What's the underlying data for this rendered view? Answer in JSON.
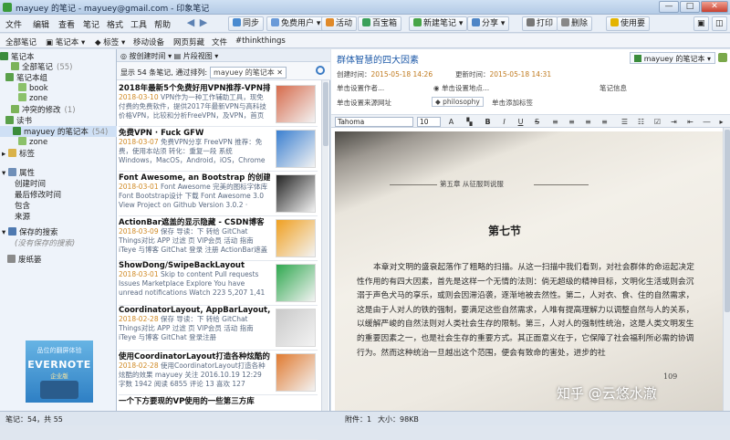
{
  "window": {
    "title": "mayuey 的笔记 - mayuey@gmail.com - 印象笔记",
    "minimize": "—",
    "maximize": "□",
    "close": "✕"
  },
  "menu": [
    "文件",
    "编辑",
    "查看",
    "笔记",
    "格式",
    "工具",
    "帮助"
  ],
  "nav": {
    "back": "◀",
    "forward": "▶"
  },
  "toolbar": {
    "sync": "同步",
    "free_user": "免费用户",
    "activity": "活动",
    "treasure": "百宝箱",
    "new_note": "新建笔记",
    "share": "分享",
    "print": "打印",
    "delete": "删除",
    "help": "使用要",
    "view": "▣",
    "save": "◫"
  },
  "subbar": [
    "全部笔记",
    "笔记本",
    "标签",
    "移动设备",
    "网页剪藏",
    "文件",
    "#thinkthings"
  ],
  "sidebar": {
    "notebooks_header": "笔记本",
    "all_notes": "全部笔记",
    "all_notes_count": "(55)",
    "notebook_group": "笔记本组",
    "group_items": [
      "book",
      "zone"
    ],
    "conflict": "冲突的修改",
    "conflict_count": "(1)",
    "book2": "读书",
    "selected_nb": "mayuey 的笔记本",
    "selected_nb_count": "(54)",
    "nb_child": "zone",
    "tags": "标签",
    "attributes": "属性",
    "attr_items": [
      "创建时间",
      "最后修改时间",
      "包含",
      "来源"
    ],
    "saved_search": "保存的搜索",
    "saved_hint": "(没有保存的搜索)",
    "trash": "废纸篓",
    "ad": {
      "line1": "品位的翻屏体验",
      "brand": "EVERNOTE",
      "line3": "企业版"
    }
  },
  "notelist": {
    "header": "◎ 按创建时间 ▾  ▤ 片段视图 ▾",
    "info": "显示 54 条笔记, 通过排列:",
    "chip": "mayuey 的笔记本 ✕",
    "notes": [
      {
        "title": "2018年最新5个免费好用VPN推荐-VPN排行网",
        "date": "2018-03-10",
        "desc": "VPN作为一种工作辅助工具，现免付费的免费软件，提供2017年最新VPN与高科技价格VPN，比较和分析FreeVPN，及VPN，首页VPN"
      },
      {
        "title": "免费VPN · Fuck GFW",
        "date": "2018-03-07",
        "desc": "免费VPN分享 FreeVPN 推荐：免费，使用本站须 转化：重复一段 系统 Windows，MacOS，Android，iOS，Chrome 中文：支持中..."
      },
      {
        "title": "Font Awesome, an Bootstrap 的创建的图标字体",
        "date": "2018-03-01",
        "desc": "Font Awesome 完美的图标字体库 Font Bootstrap设计 下载 Font Awesome 3.0 View Project on Github Version 3.0.2 · Created"
      },
      {
        "title": "ActionBar遮盖的显示隐藏 - CSDN博客",
        "date": "2018-03-09",
        "desc": "保存 导读：下 转给 GitChat Things对比 APP 过滤 页 VIP会员 活动 指南 iTeye 与博客 GitChat 登录 注册 ActionBar遮盖的..."
      },
      {
        "title": "ShowDong/SwipeBackLayout",
        "date": "2018-03-01",
        "desc": "Skip to content Pull requests Issues Marketplace Explore You have unread notifications Watch 223 5,207 1,41"
      },
      {
        "title": "CoordinatorLayout, AppBarLayout, Toolbar",
        "date": "2018-02-28",
        "desc": "保存 导读：下 转给 GitChat Things对比 APP 过滤 页 VIP会员 活动 指南 iTeye 与博客 GitChat 登录注册 CoordinatorLayout..."
      },
      {
        "title": "使用CoordinatorLayout打造各种炫酷的效果",
        "date": "2018-02-28",
        "desc": "使用CoordinatorLayout打造各种炫酷的效果 mayuey 关注 2016.10.19 12:29 字数 1942 阅读 6855 评论 13 喜欢 127"
      },
      {
        "title": "一个下方要现的VP使用的一些第三方库",
        "date": "",
        "desc": ""
      }
    ]
  },
  "editor": {
    "title": "群体智慧的四大因素",
    "notebook": "mayuey 的笔记本 ▾",
    "created_label": "创建时间：",
    "created": "2015-05-18 14:26",
    "updated_label": "更新时间：",
    "updated": "2015-05-18 14:31",
    "author_label": "单击设置作者...",
    "location_label": "单击设置地点...",
    "note_info": "笔记信息",
    "url_label": "单击设置来源网址",
    "tag": "philosophy",
    "add_tag": "单击添加标签",
    "font": "Tahoma",
    "size": "10"
  },
  "document": {
    "chapter": "第五章  从征服到说服",
    "section": "第七节",
    "text": "本章对文明的盛衰起落作了粗略的扫描。从这一扫描中我们看到，对社会群体的命运起决定性作用的有四大因素，首先是这样一个无情的法则：倘无超级的精神目标，文明化生活或则会沉溺于声色犬马的享乐，或则会因滞沿袭，逐渐地被去然性。第二，人对衣、食、住的自然需求，这是由于人对人的铁的强制，要满足这些自然需求，人唯有提高理解力以调整自然与人的关系，以缓解严峻的自然法则对人类社会生存的限制。第三，人对人的强制性统治，这是人类文明发生的重要因素之一，也是社会生存的重要方式。其正面意义在于，它保障了社会福利所必需的协调行为。然而这种统治一旦越出这个范围，便会有致命的害处，进步的社",
    "page": "109"
  },
  "watermark": "知乎 @云悠水澈",
  "status": {
    "notes": "笔记：54，共 55",
    "attach": "附件：1",
    "size": "大小：98KB"
  }
}
